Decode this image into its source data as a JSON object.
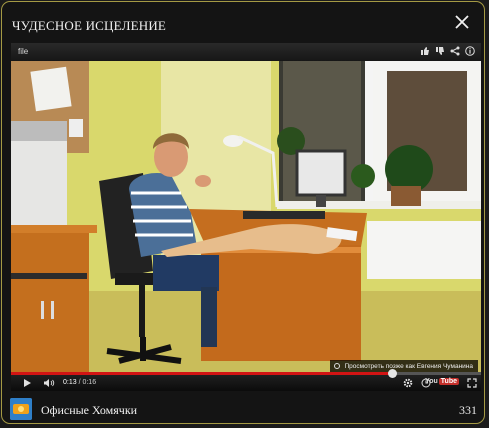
{
  "window": {
    "title": "ЧУДЕСНОЕ ИСЦЕЛЕНИЕ"
  },
  "player": {
    "top_title": "file",
    "top_icons": [
      "thumbs-up-icon",
      "thumbs-down-icon",
      "share-icon",
      "info-icon"
    ],
    "watch_later": "Просмотреть позже как Евгения Чуманина",
    "time_current": "0:13",
    "time_separator": " / ",
    "time_total": "0:16",
    "progress_fraction": 0.81,
    "logo_text": "You",
    "logo_box": "Tube"
  },
  "footer": {
    "channel_name": "Офисные Хомячки",
    "count": "331"
  },
  "colors": {
    "frame_border": "#a59a44",
    "progress_red": "#d21414",
    "background": "#141414"
  }
}
